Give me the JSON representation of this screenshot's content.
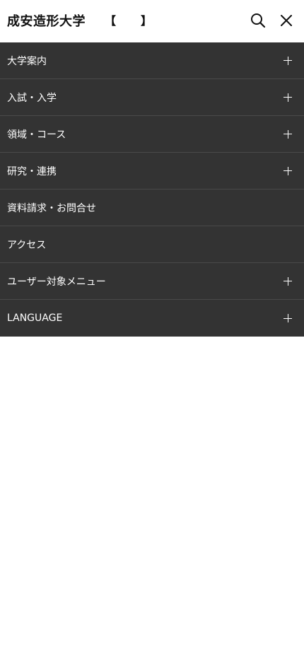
{
  "header": {
    "logo_text": "成安造形大学",
    "bracket_open": "【",
    "bracket_close": "】"
  },
  "menu": {
    "items": [
      {
        "label": "大学案内",
        "expandable": true
      },
      {
        "label": "入試・入学",
        "expandable": true
      },
      {
        "label": "領域・コース",
        "expandable": true
      },
      {
        "label": "研究・連携",
        "expandable": true
      },
      {
        "label": "資料請求・お問合せ",
        "expandable": false
      },
      {
        "label": "アクセス",
        "expandable": false
      },
      {
        "label": "ユーザー対象メニュー",
        "expandable": true
      },
      {
        "label": "LANGUAGE",
        "expandable": true
      }
    ]
  },
  "colors": {
    "menu_background": "#333333",
    "menu_divider": "#4a4a4a",
    "menu_text": "#ffffff",
    "header_background": "#ffffff",
    "header_text": "#111111"
  },
  "icons": {
    "search": "search-icon",
    "close": "close-icon",
    "expand": "plus-icon"
  }
}
